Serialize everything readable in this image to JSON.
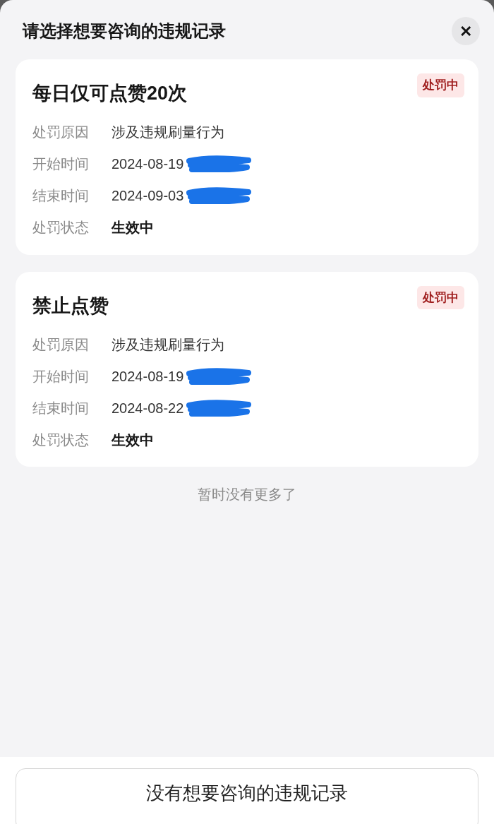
{
  "sheet": {
    "title": "请选择想要咨询的违规记录",
    "close_label": "✕"
  },
  "records": [
    {
      "title": "每日仅可点赞20次",
      "badge": "处罚中",
      "rows": [
        {
          "label": "处罚原因",
          "value": "涉及违规刷量行为",
          "kind": "plain",
          "redacted": false
        },
        {
          "label": "开始时间",
          "value": "2024-08-19",
          "kind": "plain",
          "redacted": true
        },
        {
          "label": "结束时间",
          "value": "2024-09-03",
          "kind": "plain",
          "redacted": true
        },
        {
          "label": "处罚状态",
          "value": "生效中",
          "kind": "strong",
          "redacted": false
        }
      ]
    },
    {
      "title": "禁止点赞",
      "badge": "处罚中",
      "rows": [
        {
          "label": "处罚原因",
          "value": "涉及违规刷量行为",
          "kind": "plain",
          "redacted": false
        },
        {
          "label": "开始时间",
          "value": "2024-08-19",
          "kind": "plain",
          "redacted": true
        },
        {
          "label": "结束时间",
          "value": "2024-08-22",
          "kind": "plain",
          "redacted": true
        },
        {
          "label": "处罚状态",
          "value": "生效中",
          "kind": "strong",
          "redacted": false
        }
      ]
    }
  ],
  "end_note": "暂时没有更多了",
  "footer_button": "没有想要咨询的违规记录"
}
